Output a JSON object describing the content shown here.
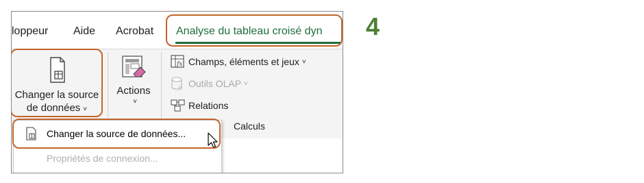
{
  "step_number": "4",
  "tabs": [
    {
      "label": "loppeur"
    },
    {
      "label": "Aide"
    },
    {
      "label": "Acrobat"
    },
    {
      "label": "Analyse du tableau croisé dyn"
    }
  ],
  "ribbon": {
    "change_source": {
      "line1": "Changer la source",
      "line2": "de données",
      "chevron": "˅"
    },
    "actions": {
      "label": "Actions",
      "chevron": "˅"
    },
    "fields_items_sets": {
      "label": "Champs, éléments et jeux",
      "chevron": "˅"
    },
    "olap_tools": {
      "label": "Outils OLAP",
      "chevron": "˅"
    },
    "relations": {
      "label": "Relations"
    },
    "calculs_group": "Calculs"
  },
  "dropdown": {
    "items": [
      {
        "label": "Changer la source de données..."
      },
      {
        "label": "Propriétés de connexion..."
      }
    ]
  },
  "colors": {
    "accent_green": "#1f6e3b",
    "highlight_orange": "#c1652a",
    "step_green": "#4f7f34"
  },
  "icons": {
    "change_source": "document-table-icon",
    "actions": "table-eraser-icon",
    "fields": "fields-formula-icon",
    "olap": "database-icon",
    "relations": "relations-icon",
    "menu_item": "document-table-icon",
    "cursor": "mouse-pointer-icon"
  }
}
